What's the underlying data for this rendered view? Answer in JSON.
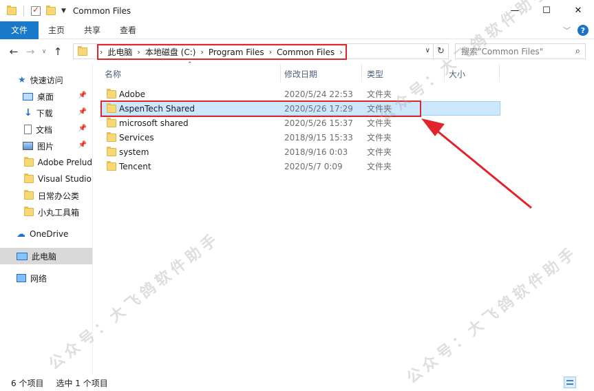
{
  "window": {
    "title": "Common Files"
  },
  "ribbon": {
    "tabs": [
      "文件",
      "主页",
      "共享",
      "查看"
    ]
  },
  "address": {
    "crumbs": [
      "此电脑",
      "本地磁盘 (C:)",
      "Program Files",
      "Common Files"
    ]
  },
  "search": {
    "placeholder": "搜索\"Common Files\""
  },
  "sidebar": {
    "items": [
      {
        "label": "快速访问",
        "icon": "star-icon"
      },
      {
        "label": "桌面",
        "icon": "desktop-icon",
        "pinned": true
      },
      {
        "label": "下载",
        "icon": "download-icon",
        "pinned": true
      },
      {
        "label": "文档",
        "icon": "document-icon",
        "pinned": true
      },
      {
        "label": "图片",
        "icon": "pictures-icon",
        "pinned": true
      },
      {
        "label": "Adobe Prelud",
        "icon": "folder-icon"
      },
      {
        "label": "Visual Studio",
        "icon": "folder-icon"
      },
      {
        "label": "日常办公类",
        "icon": "folder-icon"
      },
      {
        "label": "小丸工具箱",
        "icon": "folder-icon"
      },
      {
        "label": "OneDrive",
        "icon": "cloud-icon"
      },
      {
        "label": "此电脑",
        "icon": "computer-icon"
      },
      {
        "label": "网络",
        "icon": "network-icon"
      }
    ]
  },
  "columns": {
    "name": "名称",
    "date": "修改日期",
    "type": "类型",
    "size": "大小"
  },
  "files": [
    {
      "name": "Adobe",
      "date": "2020/5/24 22:53",
      "type": "文件夹"
    },
    {
      "name": "AspenTech Shared",
      "date": "2020/5/26 17:29",
      "type": "文件夹",
      "selected": true
    },
    {
      "name": "microsoft shared",
      "date": "2020/5/26 15:37",
      "type": "文件夹"
    },
    {
      "name": "Services",
      "date": "2018/9/15 15:33",
      "type": "文件夹"
    },
    {
      "name": "system",
      "date": "2018/9/16 0:03",
      "type": "文件夹"
    },
    {
      "name": "Tencent",
      "date": "2020/5/7 0:09",
      "type": "文件夹"
    }
  ],
  "status": {
    "count": "6 个项目",
    "selected": "选中 1 个项目"
  },
  "watermark": "公众号：大飞鸽软件助手",
  "colors": {
    "accent": "#1979ca",
    "highlight_red": "#e0242b",
    "selection": "#cce8ff"
  }
}
